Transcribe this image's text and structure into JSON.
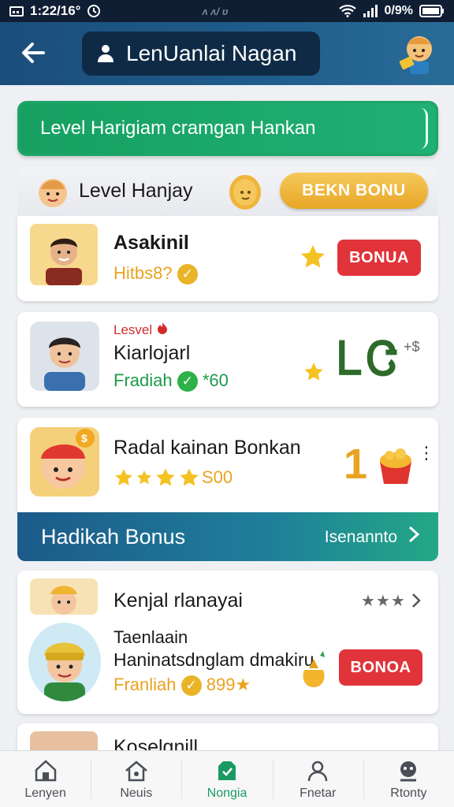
{
  "status_bar": {
    "time": "1:22/16°",
    "center": "ʌ ʌ/ ʋ",
    "battery": "0/9%"
  },
  "header": {
    "back_icon": "arrow-left-icon",
    "title": "LenUanlai Nagan",
    "user_icon": "user-icon"
  },
  "banner": {
    "text": "Level Harigiam cramgan Hankan"
  },
  "level_row": {
    "label": "Level Hanjay",
    "claim_label": "BEKN BONU"
  },
  "cards": [
    {
      "name": "Asakinil",
      "sub": "Hitbs8?",
      "button": "BONUA"
    },
    {
      "tag": "Lesvel",
      "name": "Kiarlojarl",
      "sub": "Fradiah",
      "amount": "*60",
      "value": "ᏞᏣ",
      "corner": "+$"
    },
    {
      "name": "Radal kainan Bonkan",
      "sub": "S00",
      "value": "1"
    }
  ],
  "section": {
    "title": "Hadikah Bonus",
    "link": "Isenannto"
  },
  "bonus_card": {
    "name": "Kenjal rlanayai",
    "stars": "★★★",
    "line1": "Taenlaain",
    "line2": "Haninatsdnglam dmakiru",
    "sub": "Franliah",
    "amount": "899★",
    "button": "BONOA"
  },
  "partial_card": {
    "name": "Koselgnill"
  },
  "nav": [
    {
      "label": "Lenyen",
      "icon": "home-icon"
    },
    {
      "label": "Neuis",
      "icon": "house-icon"
    },
    {
      "label": "Nongia",
      "icon": "badge-icon"
    },
    {
      "label": "Fnetar",
      "icon": "person-icon"
    },
    {
      "label": "Rtonty",
      "icon": "profile-icon"
    }
  ]
}
